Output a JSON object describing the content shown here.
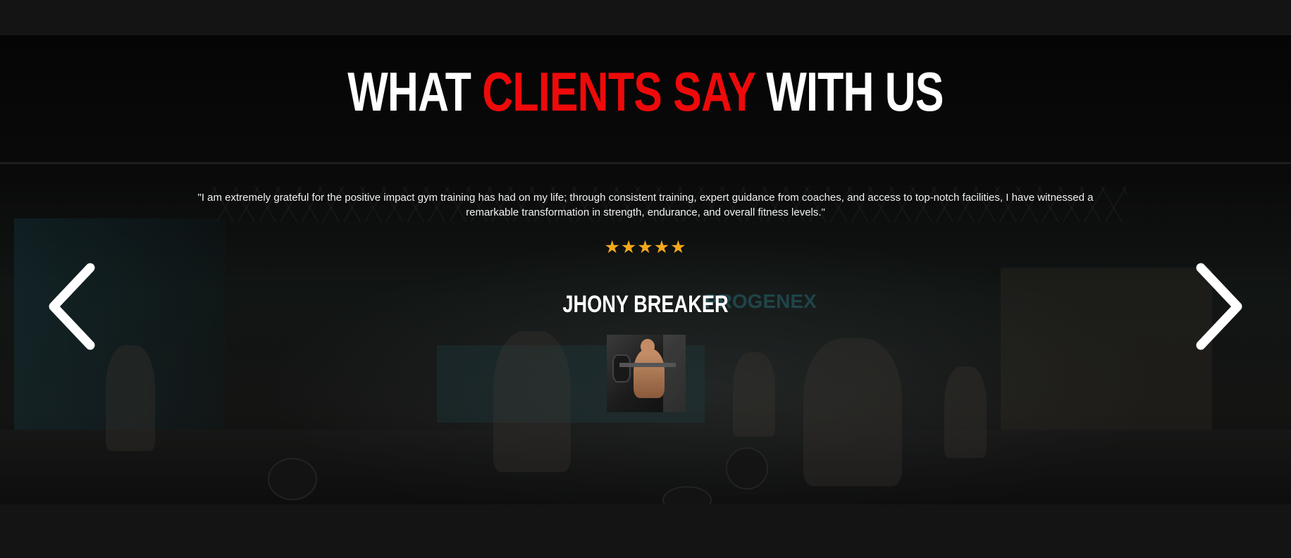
{
  "section": {
    "title_part1": "WHAT ",
    "title_accent": "CLIENTS SAY",
    "title_part2": " WITH US"
  },
  "testimonial": {
    "quote": "\"I am extremely grateful for the positive impact gym training has had on my life; through consistent training, expert guidance from coaches, and access to top-notch facilities, I have witnessed a remarkable transformation in strength, endurance, and overall fitness levels.\"",
    "stars": "★★★★★",
    "rating": 5,
    "client_name": "JHONY BREAKER"
  },
  "background": {
    "gym_sign": "PROGENEX"
  },
  "colors": {
    "accent": "#ee0a0a",
    "stars": "#f5a81c",
    "text": "#ffffff"
  },
  "icons": {
    "prev": "chevron-left-icon",
    "next": "chevron-right-icon"
  }
}
